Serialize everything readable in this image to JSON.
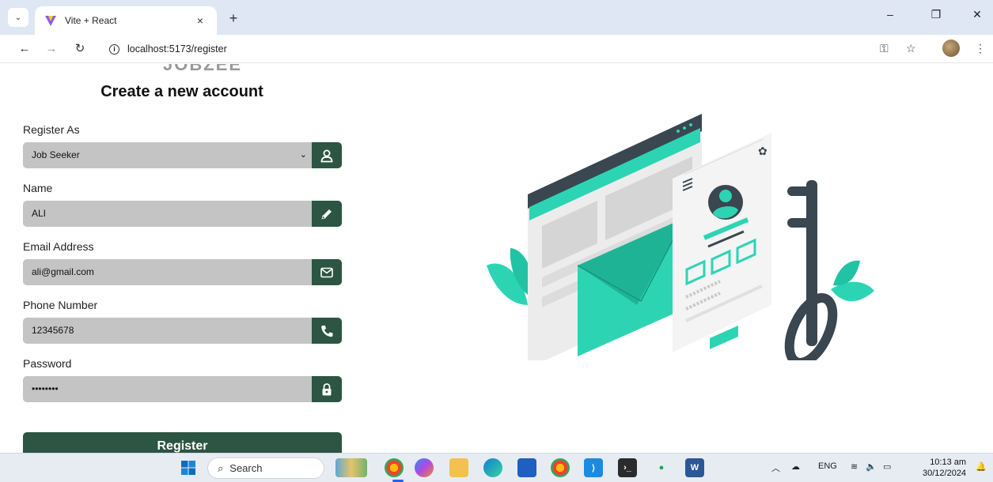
{
  "browser": {
    "tab_title": "Vite + React",
    "tab_close": "×",
    "new_tab": "+",
    "url": "localhost:5173/register",
    "minimize": "–",
    "restore": "❐",
    "close": "✕"
  },
  "page": {
    "logo_partial": "JOBZEE",
    "heading": "Create a new account",
    "fields": [
      {
        "label": "Register As",
        "value": "Job Seeker",
        "icon": "user-icon"
      },
      {
        "label": "Name",
        "value": "ALI",
        "icon": "pencil-icon"
      },
      {
        "label": "Email Address",
        "value": "ali@gmail.com",
        "icon": "mail-icon"
      },
      {
        "label": "Phone Number",
        "value": "12345678",
        "icon": "phone-icon"
      },
      {
        "label": "Password",
        "value": "••••••••",
        "icon": "lock-icon"
      }
    ],
    "register_label": "Register"
  },
  "taskbar": {
    "search_placeholder": "Search",
    "language": "ENG",
    "time": "10:13 am",
    "date": "30/12/2024"
  },
  "colors": {
    "primary": "#2c5543",
    "field_bg": "#c4c4c4",
    "accent_teal": "#2dd4b4"
  }
}
